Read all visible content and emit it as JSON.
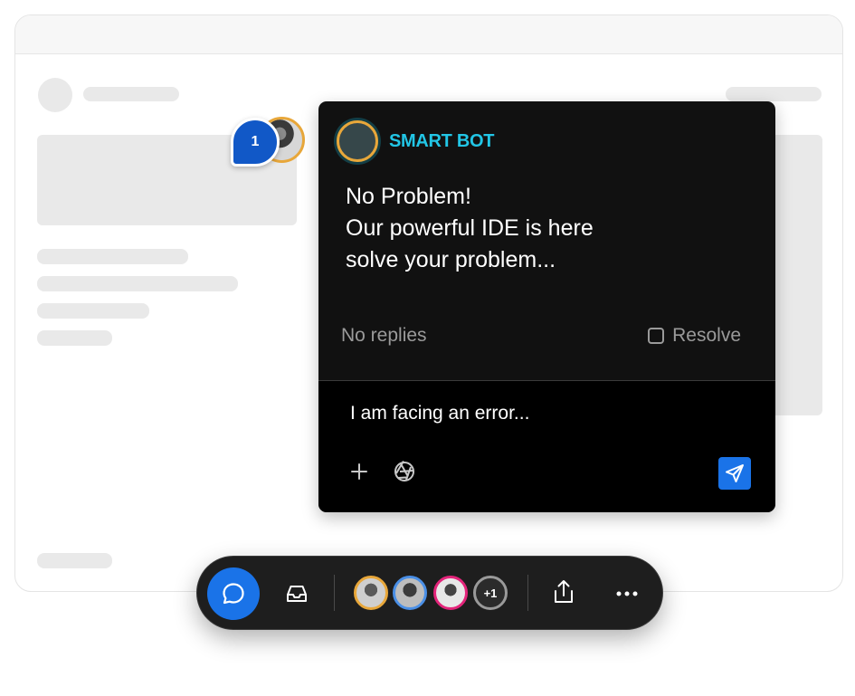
{
  "comment_marker": {
    "count": "1"
  },
  "popup": {
    "bot_name": "SMART BOT",
    "message_lines": [
      "No Problem!",
      "Our powerful IDE is here",
      "solve your problem..."
    ],
    "replies_text": "No replies",
    "resolve_label": "Resolve",
    "composer_value": "I am facing an error...",
    "icons": [
      "plus-icon",
      "aperture-icon",
      "send-icon"
    ]
  },
  "dock": {
    "extra_participants": "+1",
    "icons": [
      "chat-bubble-icon",
      "inbox-icon",
      "share-icon",
      "more-icon"
    ]
  },
  "colors": {
    "accent_blue": "#1a73e8",
    "bot_name_cyan": "#22c6e6",
    "avatar_ring_orange": "#e8a73a",
    "avatar_ring_blue": "#4a8fe6",
    "avatar_ring_pink": "#e3247a"
  }
}
